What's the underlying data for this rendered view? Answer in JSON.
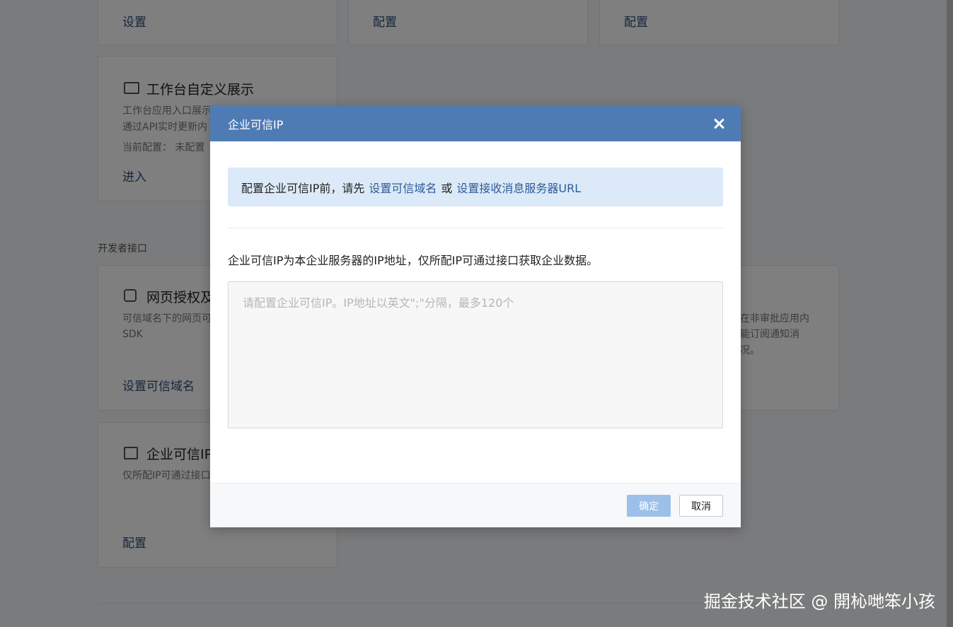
{
  "background": {
    "top_cards": [
      {
        "link": "设置"
      },
      {
        "link": "配置"
      },
      {
        "link": "配置"
      }
    ],
    "workbench_card": {
      "title": "工作台自定义展示",
      "desc_line1": "工作台应用入口展示",
      "desc_line2": "通过API实时更新内",
      "config_line": "当前配置：  未配置",
      "link": "进入"
    },
    "section_label": "开发者接口",
    "web_auth_card": {
      "title": "网页授权及",
      "desc_line1": "可信域名下的网页可",
      "desc_line2": "SDK",
      "link": "设置可信域名"
    },
    "right_card": {
      "desc_line1": "在非审批应用内",
      "desc_line2": "能订阅通知消",
      "desc_line3": "况。"
    },
    "trusted_ip_card": {
      "title": "企业可信IP",
      "desc": "仅所配IP可通过接口",
      "link": "配置"
    }
  },
  "modal": {
    "title": "企业可信IP",
    "notice_prefix": "配置企业可信IP前，请先",
    "notice_link1": "设置可信域名",
    "notice_or": "或",
    "notice_link2": "设置接收消息服务器URL",
    "description": "企业可信IP为本企业服务器的IP地址，仅所配IP可通过接口获取企业数据。",
    "input_placeholder": "请配置企业可信IP。IP地址以英文\";\"分隔，最多120个",
    "confirm_label": "确定",
    "cancel_label": "取消"
  },
  "watermark": "掘金技术社区 @ 開杺哋笨小孩",
  "colors": {
    "header": "#4f7bb5",
    "notice_bg": "#dbe9f8",
    "link": "#2d5b95",
    "confirm_disabled": "#9dc0e8"
  }
}
